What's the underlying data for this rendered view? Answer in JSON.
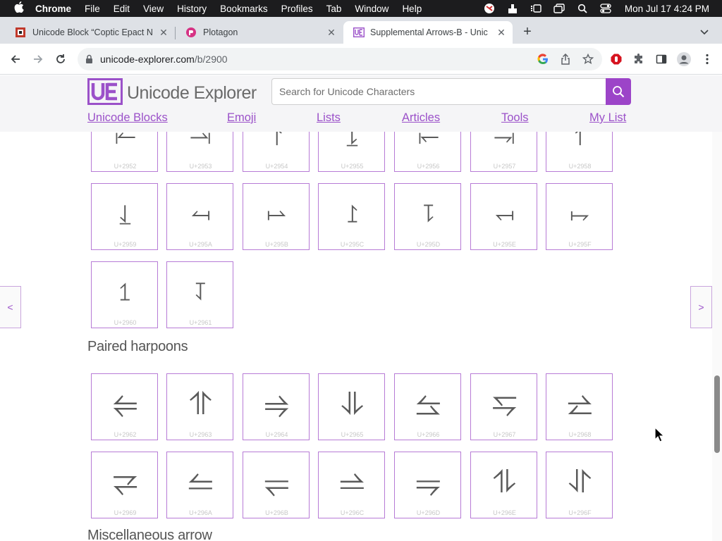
{
  "menubar": {
    "app": "Chrome",
    "items": [
      "File",
      "Edit",
      "View",
      "History",
      "Bookmarks",
      "Profiles",
      "Tab",
      "Window",
      "Help"
    ],
    "clock": "Mon Jul 17  4:24 PM"
  },
  "tabs": [
    {
      "title": "Unicode Block “Coptic Epact N",
      "favicon": "unicode-block-favicon"
    },
    {
      "title": "Plotagon",
      "favicon": "plotagon-favicon"
    },
    {
      "title": "Supplemental Arrows-B - Unic",
      "favicon": "unicode-explorer-favicon"
    }
  ],
  "toolbar": {
    "url_host": "unicode-explorer.com",
    "url_path": "/b/2900"
  },
  "site": {
    "logo_text": "Unicode Explorer",
    "search_placeholder": "Search for Unicode Characters",
    "nav": [
      "Unicode Blocks",
      "Emoji",
      "Lists",
      "Articles",
      "Tools",
      "My List"
    ]
  },
  "pager": {
    "prev": "<",
    "next": ">"
  },
  "grid_top": [
    {
      "char": "⥒",
      "code": "U+2952"
    },
    {
      "char": "⥓",
      "code": "U+2953"
    },
    {
      "char": "⥔",
      "code": "U+2954"
    },
    {
      "char": "⥕",
      "code": "U+2955"
    },
    {
      "char": "⥖",
      "code": "U+2956"
    },
    {
      "char": "⥗",
      "code": "U+2957"
    },
    {
      "char": "⥘",
      "code": "U+2958"
    },
    {
      "char": "⥙",
      "code": "U+2959"
    },
    {
      "char": "⥚",
      "code": "U+295A"
    },
    {
      "char": "⥛",
      "code": "U+295B"
    },
    {
      "char": "⥜",
      "code": "U+295C"
    },
    {
      "char": "⥝",
      "code": "U+295D"
    },
    {
      "char": "⥞",
      "code": "U+295E"
    },
    {
      "char": "⥟",
      "code": "U+295F"
    },
    {
      "char": "⥠",
      "code": "U+2960"
    },
    {
      "char": "⥡",
      "code": "U+2961"
    }
  ],
  "section_paired": "Paired harpoons",
  "grid_paired": [
    {
      "char": "⥢",
      "code": "U+2962"
    },
    {
      "char": "⥣",
      "code": "U+2963"
    },
    {
      "char": "⥤",
      "code": "U+2964"
    },
    {
      "char": "⥥",
      "code": "U+2965"
    },
    {
      "char": "⥦",
      "code": "U+2966"
    },
    {
      "char": "⥧",
      "code": "U+2967"
    },
    {
      "char": "⥨",
      "code": "U+2968"
    },
    {
      "char": "⥩",
      "code": "U+2969"
    },
    {
      "char": "⥪",
      "code": "U+296A"
    },
    {
      "char": "⥫",
      "code": "U+296B"
    },
    {
      "char": "⥬",
      "code": "U+296C"
    },
    {
      "char": "⥭",
      "code": "U+296D"
    },
    {
      "char": "⥮",
      "code": "U+296E"
    },
    {
      "char": "⥯",
      "code": "U+296F"
    }
  ],
  "section_misc": "Miscellaneous arrow"
}
